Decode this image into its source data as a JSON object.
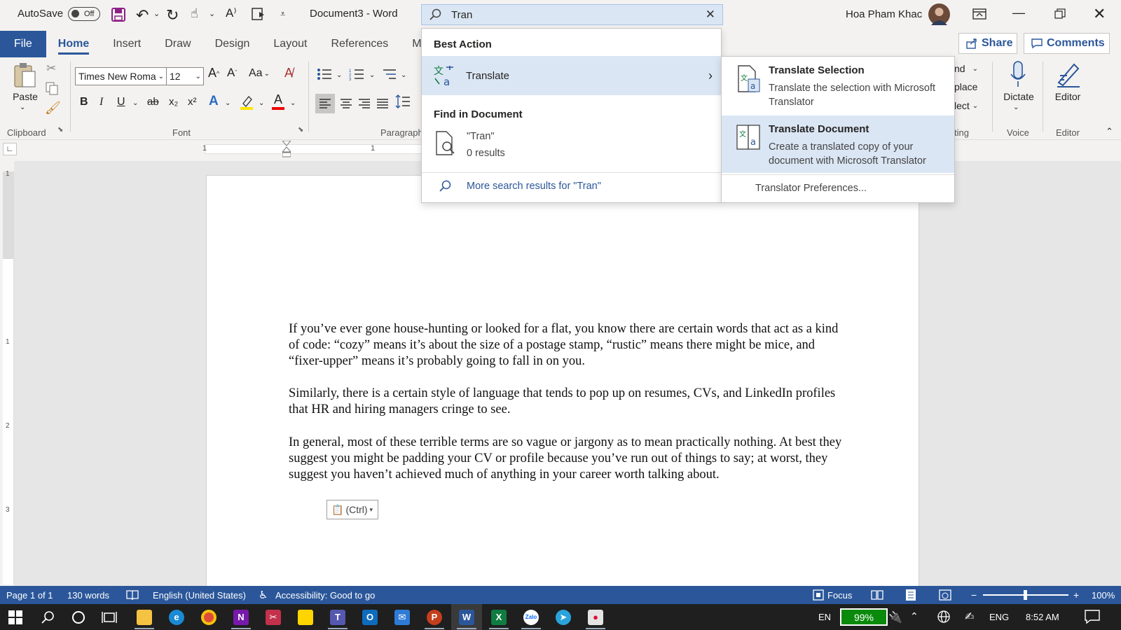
{
  "titlebar": {
    "autosave_label": "AutoSave",
    "autosave_state": "Off",
    "document_title": "Document3 - Word",
    "user_name": "Hoa Pham Khac"
  },
  "search": {
    "value": "Tran",
    "dropdown": {
      "best_action_heading": "Best Action",
      "best_action_label": "Translate",
      "find_heading": "Find in Document",
      "find_query": "\"Tran\"",
      "find_results": "0 results",
      "more_results": "More search results for \"Tran\""
    },
    "submenu": {
      "items": [
        {
          "title": "Translate Selection",
          "description": "Translate the selection with Microsoft Translator"
        },
        {
          "title": "Translate Document",
          "description": "Create a translated copy of your document with Microsoft Translator"
        }
      ],
      "preferences": "Translator Preferences..."
    }
  },
  "tabs": [
    "File",
    "Home",
    "Insert",
    "Draw",
    "Design",
    "Layout",
    "References",
    "M"
  ],
  "header_buttons": {
    "share": "Share",
    "comments": "Comments"
  },
  "ribbon": {
    "paste_label": "Paste",
    "clipboard_label": "Clipboard",
    "font_name": "Times New Roma",
    "font_size": "12",
    "font_label": "Font",
    "paragraph_label": "Paragraph",
    "editing_partial": [
      "nd",
      "place",
      "lect",
      "ting"
    ],
    "dictate_label": "Dictate",
    "voice_label": "Voice",
    "editor_label": "Editor",
    "editor_group_label": "Editor",
    "bold": "B",
    "italic": "I",
    "underline": "U",
    "strike": "ab",
    "subscript": "x₂",
    "superscript": "x²",
    "change_case": "Aa"
  },
  "ruler": {
    "left_mark": "1",
    "mid_mark": "1"
  },
  "vruler_marks": [
    "1",
    "1",
    "2",
    "3"
  ],
  "document": {
    "paragraphs": [
      "If you’ve ever gone house-hunting or looked for a flat, you know there are certain words that act  as a kind of code: “cozy” means it’s about the size of a postage stamp, “rustic” means there might be mice, and “fixer-upper” means it’s probably going to fall in on you.",
      "Similarly, there is a certain style of language that tends to pop up on resumes, CVs, and LinkedIn profiles that HR and hiring managers cringe to see.",
      "In general, most of these terrible terms are so vague or jargony as to mean practically nothing. At best they suggest you might be padding your CV or profile because you’ve run out of things to say; at worst, they suggest you haven’t achieved much of anything in your career worth talking about."
    ],
    "paste_options": "(Ctrl)"
  },
  "statusbar": {
    "page": "Page 1 of 1",
    "words": "130 words",
    "language": "English (United States)",
    "accessibility": "Accessibility: Good to go",
    "focus": "Focus",
    "zoom": "100%"
  },
  "taskbar": {
    "input_lang": "EN",
    "battery": "99%",
    "lang": "ENG",
    "time": "8:52 AM"
  },
  "colors": {
    "word_blue": "#2b579a",
    "selection_bg": "#dbe6f4",
    "taskbar": "#1f1f1f"
  }
}
